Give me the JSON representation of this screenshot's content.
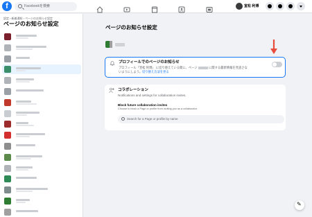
{
  "topbar": {
    "logo": "f",
    "search_placeholder": "Facebookを検索",
    "nav_icons": [
      "home-icon",
      "video-icon",
      "marketplace-icon",
      "groups-icon",
      "gaming-icon"
    ],
    "user_name": "宣松 利博",
    "right_buttons": [
      "menu-icon",
      "messenger-icon",
      "bell-icon",
      "chevron-down-icon"
    ]
  },
  "sidebar": {
    "breadcrumb": "設定 › 新着通知 › ページのお知らせ設定",
    "title": "ページのお知らせ設定",
    "item_colors": [
      "#7a1f2b",
      "#b0b3b8",
      "#9aa0a6",
      "#3a8f6a",
      "#b0b3b8",
      "#9aa0a6",
      "#c0392b",
      "#c9ccd1",
      "#9c2b2b",
      "#d32f2f",
      "#8e8e8e",
      "#5c8a4a",
      "#b0b3b8",
      "#2e8b57",
      "#7f8c8d",
      "#2e7d32",
      "#a0a0a0"
    ]
  },
  "main": {
    "title": "ページのお知らせ設定",
    "profile_notice": {
      "title": "プロフィールでのページのお知らせ",
      "desc_line1": "プロフィール「宣松 利博」 に切り替えている間に、ページ",
      "desc_mid": "に関する最新情報を見逃さな",
      "desc_line2": "いようにしよう。",
      "link": "切り替え方法を見る",
      "toggle_on": false
    },
    "collab": {
      "title": "コラボレーション",
      "subtitle": "Notifications and settings for collaboration invites.",
      "block_title": "Block future collaboration invites",
      "block_desc": "Choose to block a Page or profile from inviting you as a collaborator.",
      "search_placeholder": "Search for a Page or profile by name"
    }
  },
  "colors": {
    "accent": "#1877f2",
    "arrow": "#e74c3c"
  }
}
